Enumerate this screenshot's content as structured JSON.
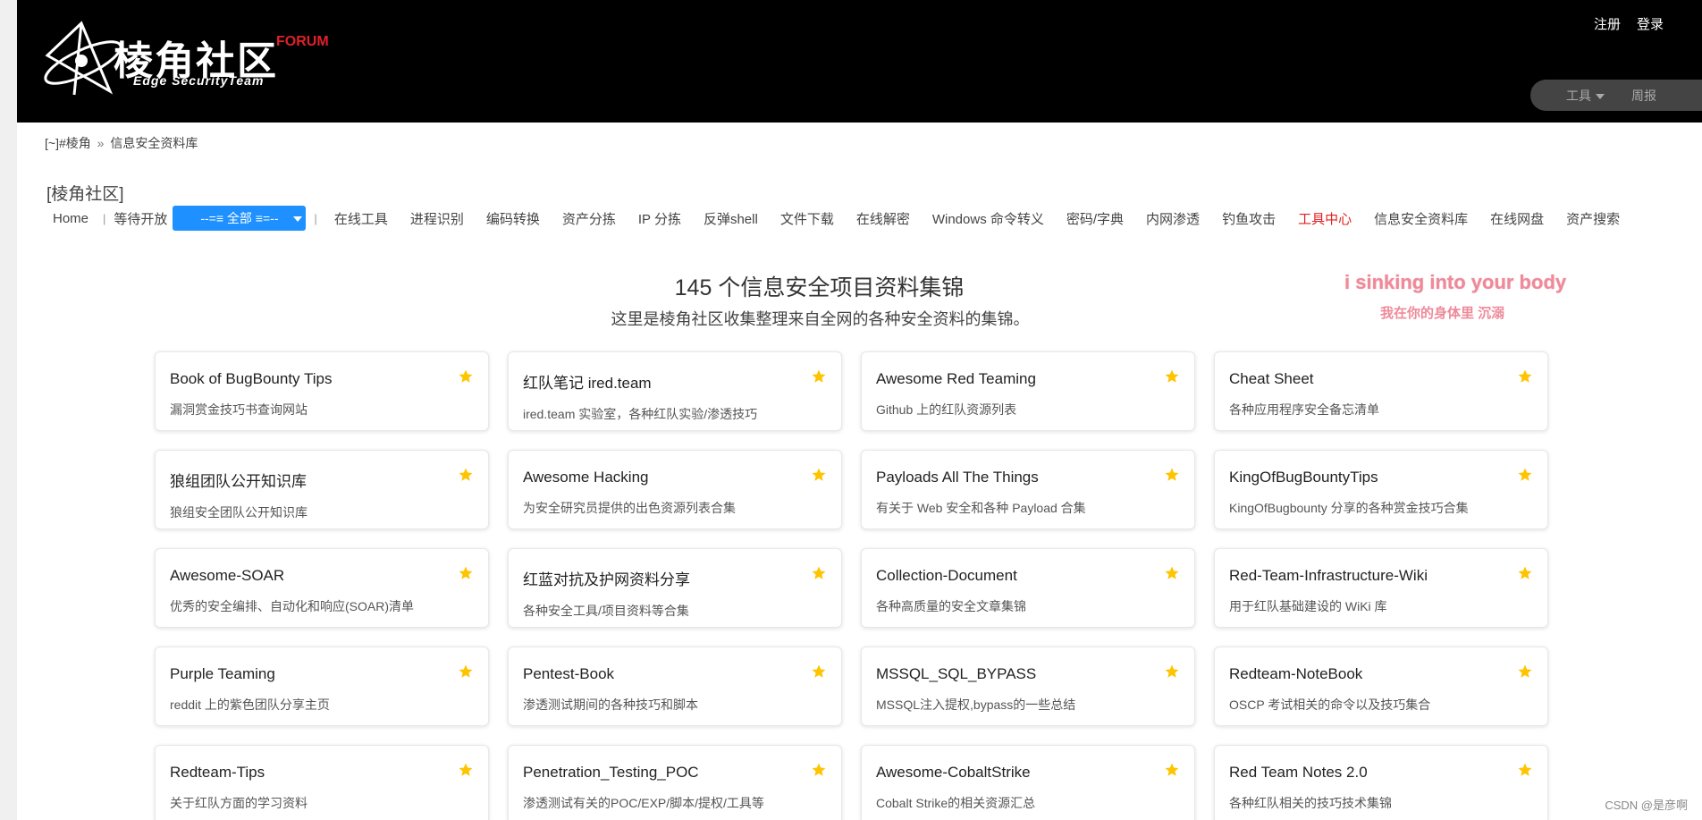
{
  "header": {
    "logo_title": "棱角社区",
    "logo_forum": "FORUM",
    "logo_sub": "Edge SecurityTeam",
    "register": "注册",
    "login": "登录",
    "tools": "工具",
    "weekly": "周报"
  },
  "breadcrumb": {
    "root": "[~]#棱角",
    "sep": "»",
    "current": "信息安全资料库"
  },
  "section_title": "[棱角社区]",
  "nav": {
    "home": "Home",
    "waiting": "等待开放",
    "select_value": "--=≡ 全部 ≡=--",
    "items": [
      "在线工具",
      "进程识别",
      "编码转换",
      "资产分拣",
      "IP 分拣",
      "反弹shell",
      "文件下载",
      "在线解密",
      "Windows 命令转义",
      "密码/字典",
      "内网渗透",
      "钓鱼攻击",
      "工具中心",
      "信息安全资料库",
      "在线网盘",
      "资产搜索"
    ],
    "highlight_color": "#e02020"
  },
  "main": {
    "title": "145 个信息安全项目资料集锦",
    "subtitle": "这里是棱角社区收集整理来自全网的各种安全资料的集锦。",
    "pink_line1": "i sinking into your body",
    "pink_line2": "我在你的身体里 沉溺"
  },
  "cards": [
    {
      "title": "Book of BugBounty Tips",
      "desc": "漏洞赏金技巧书查询网站"
    },
    {
      "title": "红队笔记 ired.team",
      "desc": "ired.team 实验室，各种红队实验/渗透技巧"
    },
    {
      "title": "Awesome Red Teaming",
      "desc": "Github 上的红队资源列表"
    },
    {
      "title": "Cheat Sheet",
      "desc": "各种应用程序安全备忘清单"
    },
    {
      "title": "狼组团队公开知识库",
      "desc": "狼组安全团队公开知识库"
    },
    {
      "title": "Awesome Hacking",
      "desc": "为安全研究员提供的出色资源列表合集"
    },
    {
      "title": "Payloads All The Things",
      "desc": "有关于 Web 安全和各种 Payload 合集"
    },
    {
      "title": "KingOfBugBountyTips",
      "desc": "KingOfBugbounty 分享的各种赏金技巧合集"
    },
    {
      "title": "Awesome-SOAR",
      "desc": "优秀的安全编排、自动化和响应(SOAR)清单"
    },
    {
      "title": "红蓝对抗及护网资料分享",
      "desc": "各种安全工具/项目资料等合集"
    },
    {
      "title": "Collection-Document",
      "desc": "各种高质量的安全文章集锦"
    },
    {
      "title": "Red-Team-Infrastructure-Wiki",
      "desc": "用于红队基础建设的 WiKi 库"
    },
    {
      "title": "Purple Teaming",
      "desc": "reddit 上的紫色团队分享主页"
    },
    {
      "title": "Pentest-Book",
      "desc": "渗透测试期间的各种技巧和脚本"
    },
    {
      "title": "MSSQL_SQL_BYPASS",
      "desc": "MSSQL注入提权,bypass的一些总结"
    },
    {
      "title": "Redteam-NoteBook",
      "desc": "OSCP 考试相关的命令以及技巧集合"
    },
    {
      "title": "Redteam-Tips",
      "desc": "关于红队方面的学习资料"
    },
    {
      "title": "Penetration_Testing_POC",
      "desc": "渗透测试有关的POC/EXP/脚本/提权/工具等"
    },
    {
      "title": "Awesome-CobaltStrike",
      "desc": "Cobalt Strike的相关资源汇总"
    },
    {
      "title": "Red Team Notes 2.0",
      "desc": "各种红队相关的技巧技术集锦"
    }
  ],
  "star_color": "#ffc400",
  "watermark": "CSDN @是彦啊"
}
